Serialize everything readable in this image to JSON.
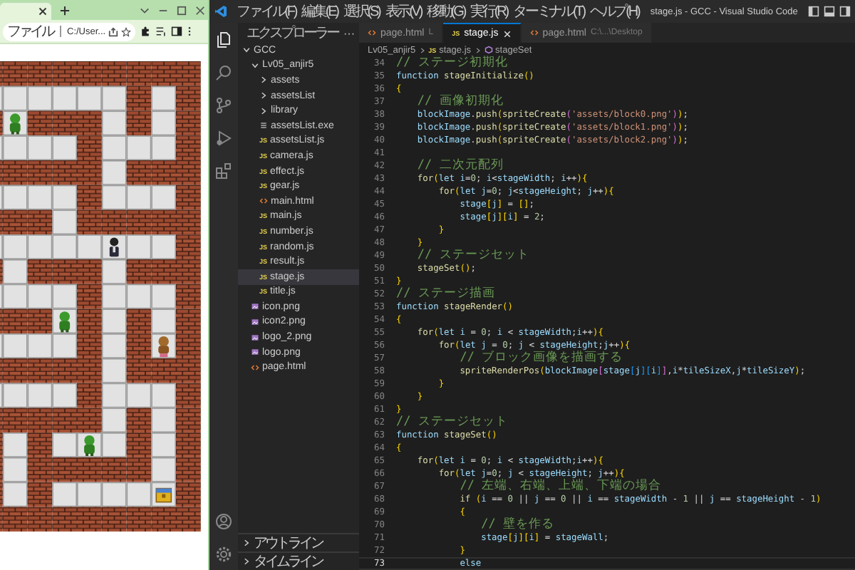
{
  "browser": {
    "address_scheme": "ファイル",
    "address": "C:/User..."
  },
  "vscode": {
    "menu": [
      "ファイル(F)",
      "編集(E)",
      "選択(S)",
      "表示(V)",
      "移動(G)",
      "実行(R)",
      "ターミナル(T)",
      "ヘルプ(H)"
    ],
    "title": "stage.js - GCC - Visual Studio Code",
    "explorer": {
      "title": "エクスプローラー",
      "more": "···",
      "tree": [
        {
          "name": "GCC",
          "kind": "folder",
          "expanded": true,
          "selected": false,
          "children": [
            {
              "name": "Lv05_anjir5",
              "kind": "folder",
              "expanded": true,
              "selected": false,
              "children": [
                {
                  "name": "assets",
                  "kind": "folder",
                  "expanded": false,
                  "selected": false
                },
                {
                  "name": "assetsList",
                  "kind": "folder",
                  "expanded": false,
                  "selected": false
                },
                {
                  "name": "library",
                  "kind": "folder",
                  "expanded": false,
                  "selected": false
                },
                {
                  "name": "assetsList.exe",
                  "kind": "exe",
                  "selected": false
                },
                {
                  "name": "assetsList.js",
                  "kind": "js",
                  "icon_label": "JS",
                  "selected": false
                },
                {
                  "name": "camera.js",
                  "kind": "js",
                  "icon_label": "JS",
                  "selected": false
                },
                {
                  "name": "effect.js",
                  "kind": "js",
                  "icon_label": "JS",
                  "selected": false
                },
                {
                  "name": "gear.js",
                  "kind": "js",
                  "icon_label": "JS",
                  "selected": false
                },
                {
                  "name": "main.html",
                  "kind": "html",
                  "selected": false
                },
                {
                  "name": "main.js",
                  "kind": "js",
                  "icon_label": "JS",
                  "selected": false
                },
                {
                  "name": "number.js",
                  "kind": "js",
                  "icon_label": "JS",
                  "selected": false
                },
                {
                  "name": "random.js",
                  "kind": "js",
                  "icon_label": "JS",
                  "selected": false
                },
                {
                  "name": "result.js",
                  "kind": "js",
                  "icon_label": "JS",
                  "selected": false
                },
                {
                  "name": "stage.js",
                  "kind": "js",
                  "icon_label": "JS",
                  "selected": true
                },
                {
                  "name": "title.js",
                  "kind": "js",
                  "icon_label": "JS",
                  "selected": false
                }
              ]
            },
            {
              "name": "icon.png",
              "kind": "png",
              "selected": false
            },
            {
              "name": "icon2.png",
              "kind": "png",
              "selected": false
            },
            {
              "name": "logo_2.png",
              "kind": "png",
              "selected": false
            },
            {
              "name": "logo.png",
              "kind": "png",
              "selected": false
            },
            {
              "name": "page.html",
              "kind": "html",
              "selected": false
            }
          ]
        }
      ],
      "sections": [
        {
          "label": "アウトライン",
          "expanded": false
        },
        {
          "label": "タイムライン",
          "expanded": false
        }
      ]
    },
    "tabs": [
      {
        "label": "page.html",
        "kind": "html",
        "detail": "L",
        "selected": false
      },
      {
        "label": "stage.js",
        "kind": "js",
        "icon_label": "JS",
        "selected": true
      },
      {
        "label": "page.html",
        "kind": "html",
        "detail": "C:\\...\\Desktop",
        "selected": false
      }
    ],
    "breadcrumb": [
      {
        "label": "Lv05_anjir5",
        "kind": "folder"
      },
      {
        "label": "stage.js",
        "kind": "js",
        "icon_label": "JS"
      },
      {
        "label": "stageSet",
        "kind": "function"
      }
    ],
    "code": [
      {
        "number": "34",
        "text": "// ステージ初期化",
        "current": false
      },
      {
        "number": "35",
        "text": "function stageInitialize()",
        "current": false
      },
      {
        "number": "36",
        "text": "{",
        "current": false
      },
      {
        "number": "37",
        "text": "    // 画像初期化",
        "current": false
      },
      {
        "number": "38",
        "text": "    blockImage.push(spriteCreate('assets/block0.png'));",
        "current": false
      },
      {
        "number": "39",
        "text": "    blockImage.push(spriteCreate('assets/block1.png'));",
        "current": false
      },
      {
        "number": "40",
        "text": "    blockImage.push(spriteCreate('assets/block2.png'));",
        "current": false
      },
      {
        "number": "41",
        "current": false
      },
      {
        "number": "42",
        "text": "    // 二次元配列",
        "current": false
      },
      {
        "number": "43",
        "text": "    for(let i=0; i<stageWidth; i++){",
        "current": false
      },
      {
        "number": "44",
        "text": "        for(let j=0; j<stageHeight; j++){",
        "current": false
      },
      {
        "number": "45",
        "text": "            stage[j] = [];",
        "current": false
      },
      {
        "number": "46",
        "text": "            stage[j][i] = 2;",
        "current": false
      },
      {
        "number": "47",
        "text": "        }",
        "current": false
      },
      {
        "number": "48",
        "text": "    }",
        "current": false
      },
      {
        "number": "49",
        "text": "    // ステージセット",
        "current": false
      },
      {
        "number": "50",
        "text": "    stageSet();",
        "current": false
      },
      {
        "number": "51",
        "text": "}",
        "current": false
      },
      {
        "number": "52",
        "text": "// ステージ描画",
        "current": false
      },
      {
        "number": "53",
        "text": "function stageRender()",
        "current": false
      },
      {
        "number": "54",
        "text": "{",
        "current": false
      },
      {
        "number": "55",
        "text": "    for(let i = 0; i < stageWidth;i++){",
        "current": false
      },
      {
        "number": "56",
        "text": "        for(let j = 0; j < stageHeight;j++){",
        "current": false
      },
      {
        "number": "57",
        "text": "            // ブロック画像を描画する",
        "current": false
      },
      {
        "number": "58",
        "text": "            spriteRenderPos(blockImage[stage[j][i]],i*tileSizeX,j*tileSizeY);",
        "current": false
      },
      {
        "number": "59",
        "text": "        }",
        "current": false
      },
      {
        "number": "60",
        "text": "    }",
        "current": false
      },
      {
        "number": "61",
        "text": "}",
        "current": false
      },
      {
        "number": "62",
        "text": "// ステージセット",
        "current": false
      },
      {
        "number": "63",
        "text": "function stageSet()",
        "current": false
      },
      {
        "number": "64",
        "text": "{",
        "current": false
      },
      {
        "number": "65",
        "text": "    for(let i = 0; i < stageWidth;i++){",
        "current": false
      },
      {
        "number": "66",
        "text": "        for(let j=0; j < stageHeight; j++){",
        "current": false
      },
      {
        "number": "67",
        "text": "            // 左端、右端、上端、下端の場合",
        "current": false
      },
      {
        "number": "68",
        "text": "            if (i == 0 || j == 0 || i == stageWidth - 1 || j == stageHeight - 1)",
        "current": false
      },
      {
        "number": "69",
        "text": "            {",
        "current": false
      },
      {
        "number": "70",
        "text": "                // 壁を作る",
        "current": false
      },
      {
        "number": "71",
        "text": "                stage[j][i] = stageWall;",
        "current": false
      },
      {
        "number": "72",
        "text": "            }",
        "current": false
      },
      {
        "number": "73",
        "text": "            else",
        "current": true
      }
    ]
  }
}
